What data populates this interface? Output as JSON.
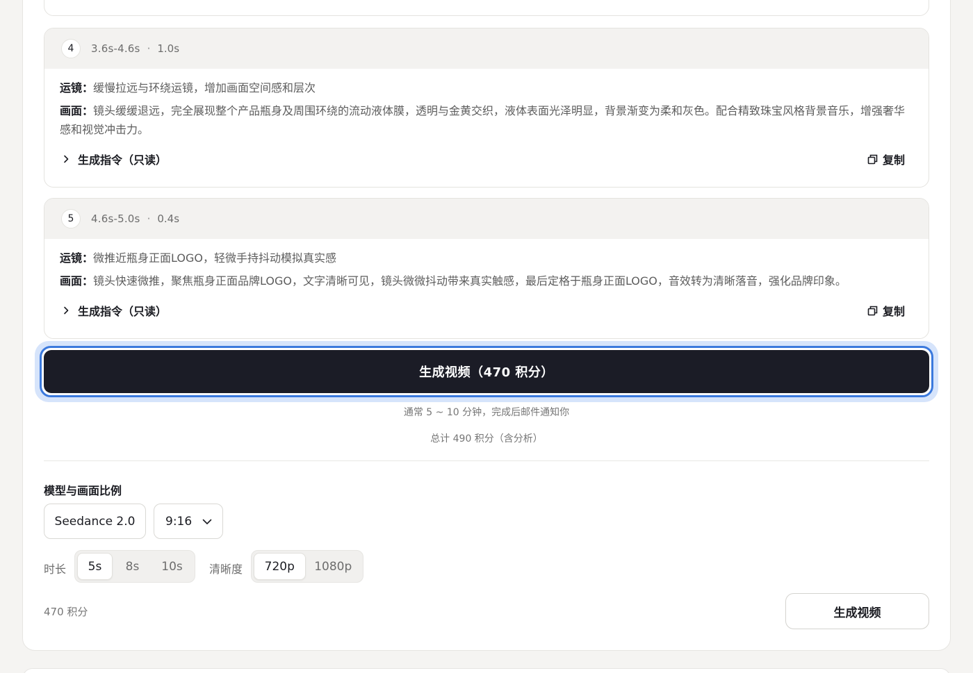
{
  "segments": [
    {
      "num": "4",
      "time": "3.6s-4.6s",
      "sep": "·",
      "dur": "1.0s",
      "camera_key": "运镜：",
      "camera": "缓慢拉远与环绕运镜，增加画面空间感和层次",
      "scene_key": "画面：",
      "scene": "镜头缓缓退远，完全展现整个产品瓶身及周围环绕的流动液体膜，透明与金黄交织，液体表面光泽明显，背景渐变为柔和灰色。配合精致珠宝风格背景音乐，增强奢华感和视觉冲击力。",
      "cmd_label": "生成指令（只读）",
      "copy_label": "复制"
    },
    {
      "num": "5",
      "time": "4.6s-5.0s",
      "sep": "·",
      "dur": "0.4s",
      "camera_key": "运镜：",
      "camera": "微推近瓶身正面LOGO，轻微手持抖动模拟真实感",
      "scene_key": "画面：",
      "scene": "镜头快速微推，聚焦瓶身正面品牌LOGO，文字清晰可见，镜头微微抖动带来真实触感，最后定格于瓶身正面LOGO，音效转为清晰落音，强化品牌印象。",
      "cmd_label": "生成指令（只读）",
      "copy_label": "复制"
    }
  ],
  "generate": {
    "label": "生成视频（470 积分）",
    "note": "通常 5 ~ 10 分钟，完成后邮件通知你",
    "total": "总计 490 积分（含分析）"
  },
  "settings": {
    "title": "模型与画面比例",
    "model": "Seedance 2.0",
    "ratio": "9:16",
    "duration_label": "时长",
    "durations": [
      "5s",
      "8s",
      "10s"
    ],
    "duration_selected": "5s",
    "resolution_label": "清晰度",
    "resolutions": [
      "720p",
      "1080p"
    ],
    "resolution_selected": "720p"
  },
  "footer": {
    "credits": "470 积分",
    "button": "生成视频"
  }
}
